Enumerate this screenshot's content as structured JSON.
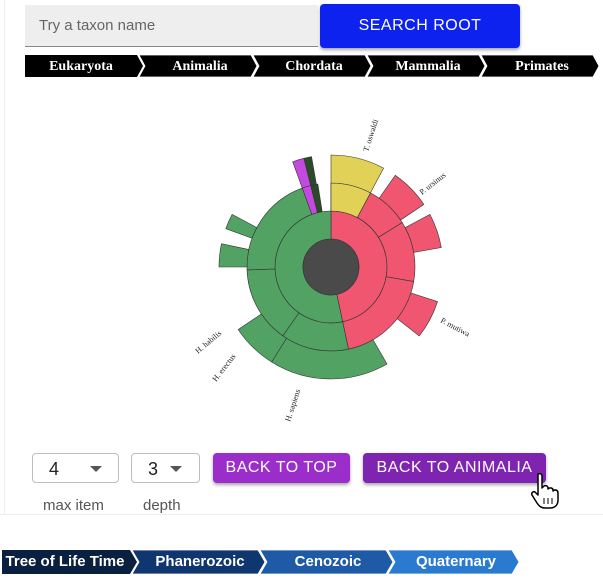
{
  "search": {
    "placeholder": "Try a taxon name",
    "value": "",
    "button_label": "SEARCH ROOT"
  },
  "breadcrumb_top": [
    "Eukaryota",
    "Animalia",
    "Chordata",
    "Mammalia",
    "Primates"
  ],
  "sunburst": {
    "labels": [
      "T. oswaldi",
      "P. ursinus",
      "P. mutiwa",
      "H. sapiens",
      "H. erectus",
      "H. habilis"
    ],
    "colors": {
      "green": "#52a263",
      "pink": "#f0566f",
      "yellow": "#e1d257",
      "purple": "#c449e0",
      "center": "#4a4a4a",
      "dark": "#2a4b2a"
    }
  },
  "controls": {
    "max_item": {
      "value": "4",
      "caption": "max item"
    },
    "depth": {
      "value": "3",
      "caption": "depth"
    },
    "back_to_top": "BACK TO TOP",
    "back_to": "BACK TO ANIMALIA",
    "colors": {
      "back_to_top": "#9b2ecb",
      "back_to": "#7f24b0"
    }
  },
  "breadcrumb_bottom": [
    "Tree of Life Time",
    "Phanerozoic",
    "Cenozoic",
    "Quaternary"
  ],
  "colors": {
    "search_button": "#0d21ef",
    "crumb_dark": "#0a2040",
    "crumb_mid": "#103670",
    "crumb_blue": "#1e5aa6",
    "crumb_light": "#2a7ad0"
  }
}
